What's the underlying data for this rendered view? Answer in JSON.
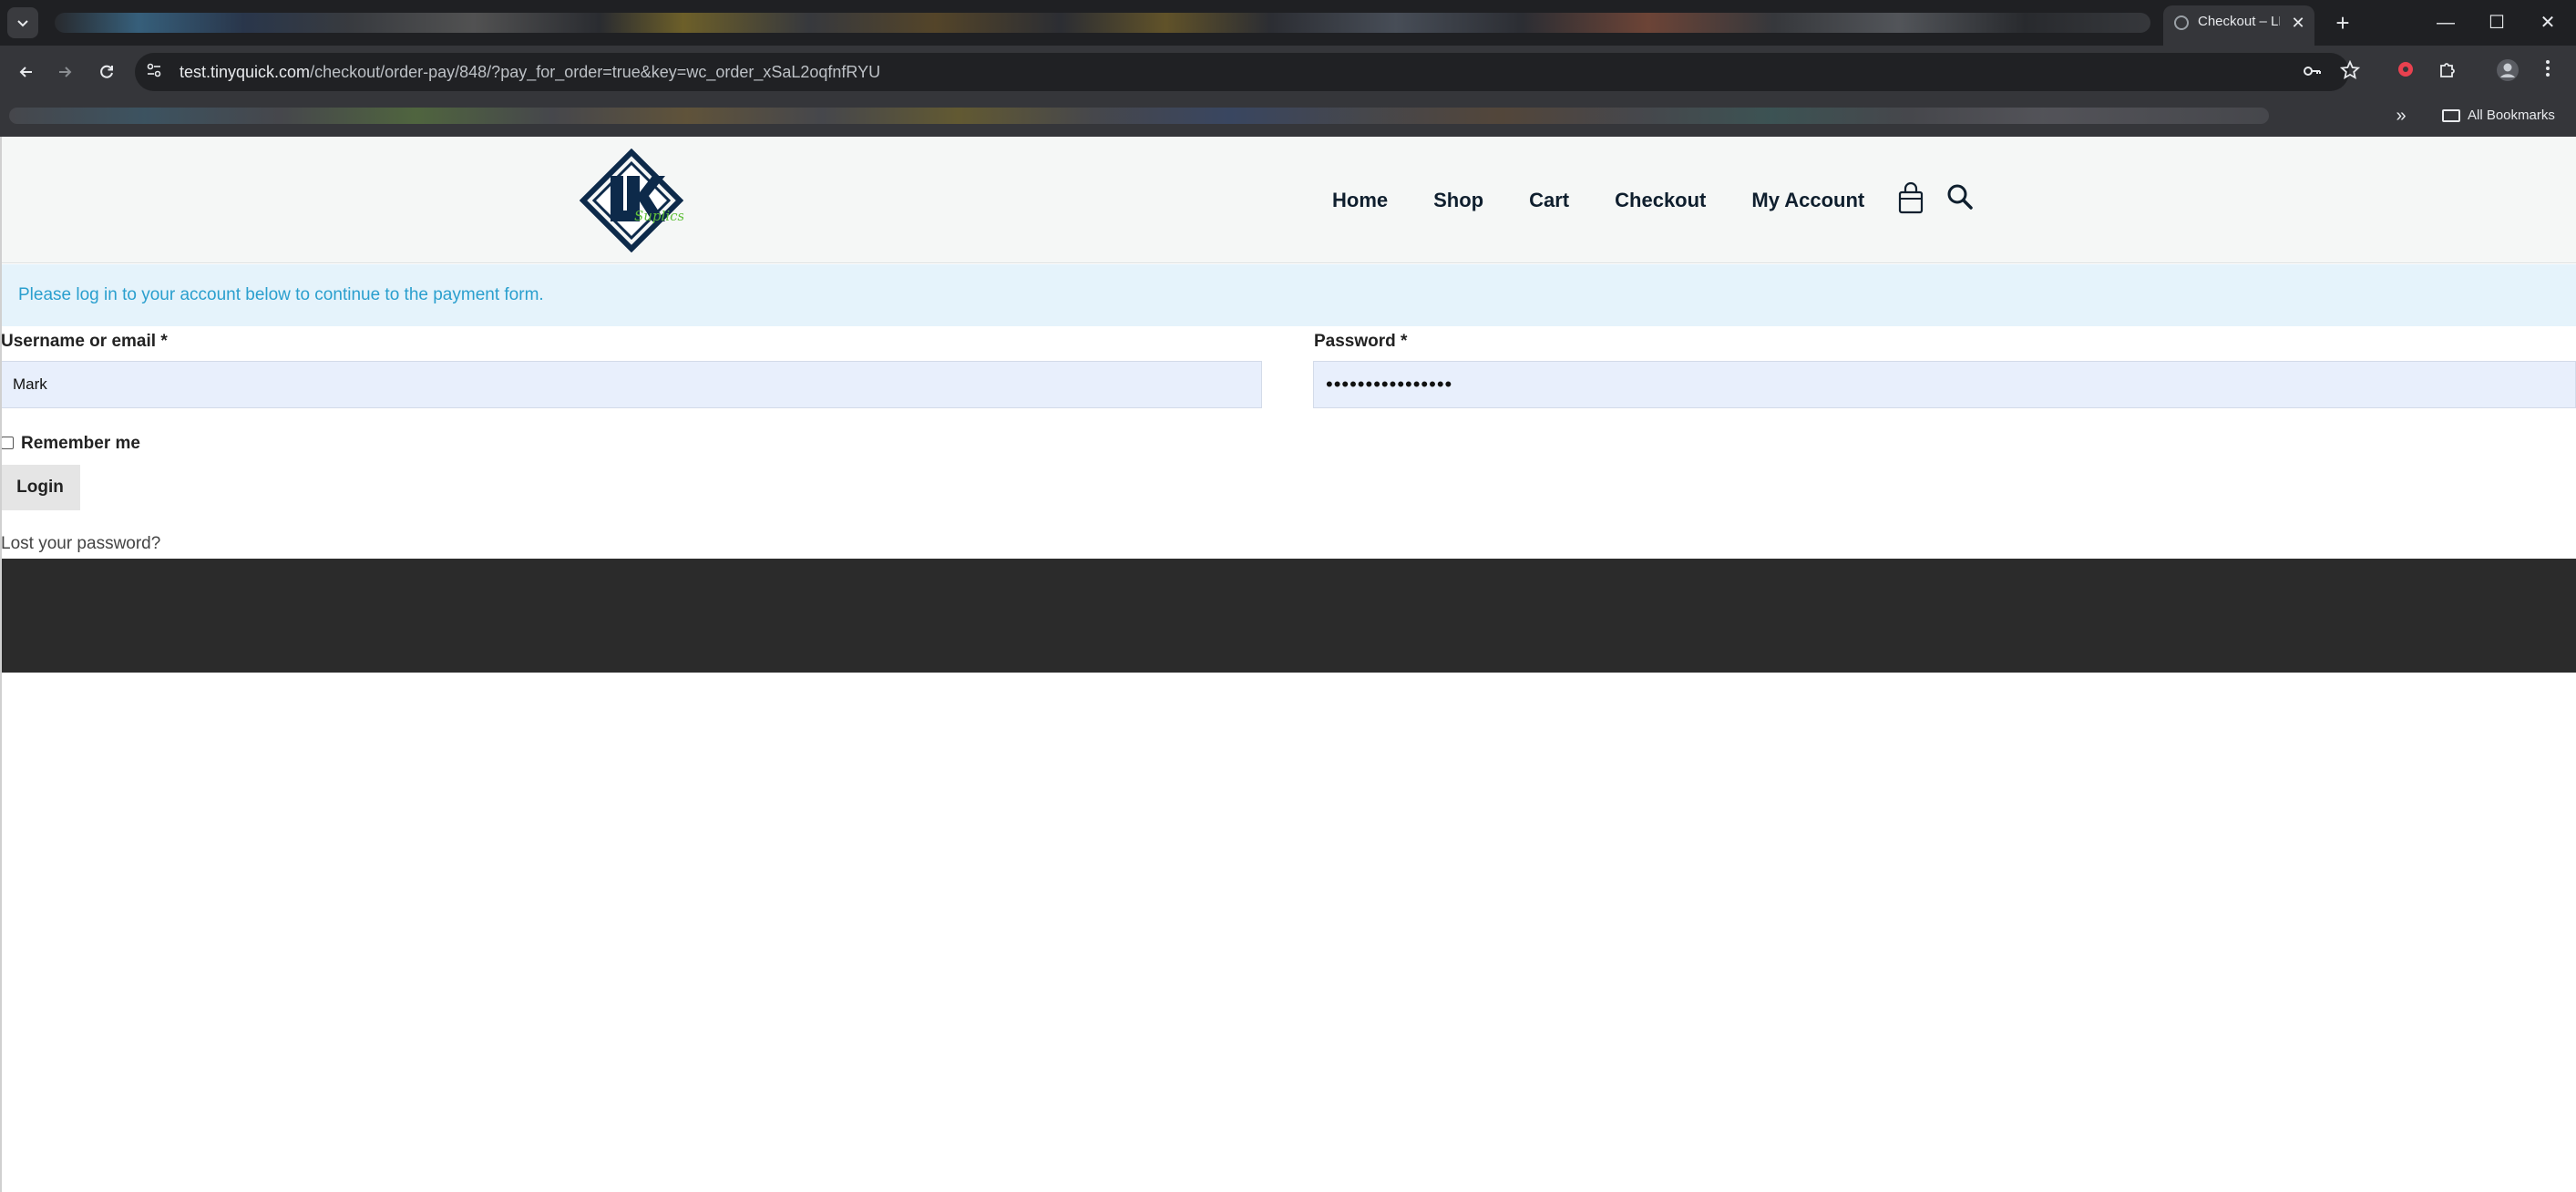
{
  "browser": {
    "tab_list_icon": "chevron-down-icon",
    "active_tab_title": "Checkout – LK",
    "tab_close_glyph": "✕",
    "new_tab_glyph": "+",
    "window_controls": {
      "minimize": "—",
      "maximize": "☐",
      "close": "✕"
    },
    "url_host": "test.tinyquick.com",
    "url_path": "/checkout/order-pay/848/?pay_for_order=true&key=wc_order_xSaL2oqfnfRYU",
    "bookmarks": {
      "all_bookmarks_label": "All Bookmarks",
      "overflow_glyph": "»"
    }
  },
  "site": {
    "logo_letters": "LK",
    "nav": [
      "Home",
      "Shop",
      "Cart",
      "Checkout",
      "My Account"
    ],
    "cart_icon": "shopping-bag-icon",
    "search_icon": "search-icon"
  },
  "notice": {
    "text": "Please log in to your account below to continue to the payment form."
  },
  "login_form": {
    "username_label": "Username or email",
    "password_label": "Password",
    "required_mark": "*",
    "username_value": "Mark",
    "password_value": "••••••••••••••••",
    "remember_label": "Remember me",
    "login_button": "Login",
    "lost_password_link": "Lost your password?"
  },
  "colors": {
    "notice_background": "#e5f3fb",
    "notice_text": "#2a9fce",
    "input_background": "#e8effc",
    "footer_background": "#2b2b2b",
    "header_background": "#f5f7f6",
    "logo_navy": "#0d2a4a",
    "logo_green": "#5fbf3a"
  }
}
